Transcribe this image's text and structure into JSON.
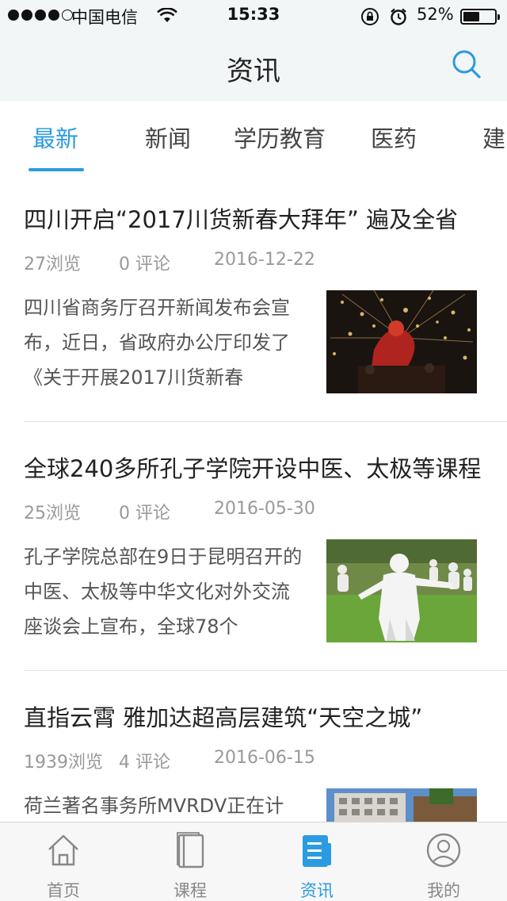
{
  "status_bar": {
    "carrier": "中国电信",
    "time": "15:33",
    "battery_percent": "52%",
    "battery_level": 0.52,
    "icons": [
      "signal-dots",
      "wifi-icon",
      "orientation-lock-icon",
      "alarm-icon",
      "battery-icon"
    ]
  },
  "nav": {
    "title": "资讯",
    "search_icon": "search-icon"
  },
  "tabs": [
    {
      "label": "最新",
      "active": true
    },
    {
      "label": "新闻",
      "active": false
    },
    {
      "label": "学历教育",
      "active": false
    },
    {
      "label": "医药",
      "active": false
    },
    {
      "label": "建",
      "active": false
    }
  ],
  "articles": [
    {
      "title": "四川开启“2017川货新春大拜年” 遍及全省",
      "views": "27浏览",
      "comments": "0 评论",
      "date": "2016-12-22",
      "summary": "四川省商务厅召开新闻发布会宣布，近日，省政府办公厅印发了《关于开展2017川货新春",
      "thumb": "fireworks-dragon-dance-photo"
    },
    {
      "title": "全球240多所孔子学院开设中医、太极等课程",
      "views": "25浏览",
      "comments": "0 评论",
      "date": "2016-05-30",
      "summary": "孔子学院总部在9日于昆明召开的中医、太极等中华文化对外交流座谈会上宣布，全球78个",
      "thumb": "tai-chi-statues-photo"
    },
    {
      "title": "直指云霄 雅加达超高层建筑“天空之城”",
      "views": "1939浏览",
      "comments": "4 评论",
      "date": "2016-06-15",
      "summary": "荷兰著名事务所MVRDV正在计划",
      "thumb": "skyscraper-photo"
    }
  ],
  "tabbar": [
    {
      "label": "首页",
      "icon": "home-icon",
      "active": false
    },
    {
      "label": "课程",
      "icon": "book-icon",
      "active": false
    },
    {
      "label": "资讯",
      "icon": "news-icon",
      "active": true
    },
    {
      "label": "我的",
      "icon": "profile-icon",
      "active": false
    }
  ],
  "colors": {
    "accent": "#2a9be0",
    "bar_background": "#f3f6f6",
    "meta_text": "#999999"
  }
}
